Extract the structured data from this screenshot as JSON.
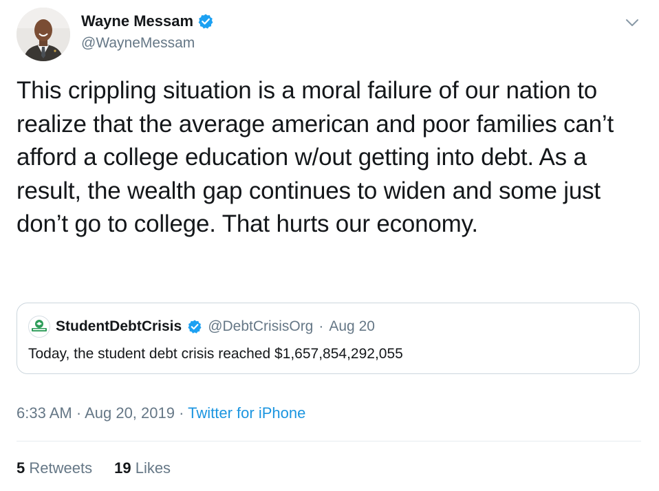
{
  "author": {
    "display_name": "Wayne Messam",
    "handle": "@WayneMessam",
    "verified": true
  },
  "tweet": {
    "text": "This crippling situation is a moral failure of our nation to realize that the average american and poor families can’t afford a college education w/out getting into debt. As a result, the wealth gap continues to widen and some just don’t go to college. That hurts our economy."
  },
  "quoted_tweet": {
    "display_name": "StudentDebtCrisis",
    "handle": "@DebtCrisisOrg",
    "separator": "·",
    "date": "Aug 20",
    "text": "Today, the student debt crisis reached $1,657,854,292,055",
    "verified": true
  },
  "meta": {
    "time": "6:33 AM",
    "separator_1": "·",
    "date": "Aug 20, 2019",
    "separator_2": "·",
    "source": "Twitter for iPhone"
  },
  "stats": {
    "retweets_count": "5",
    "retweets_label": "Retweets",
    "likes_count": "19",
    "likes_label": "Likes"
  },
  "colors": {
    "verified_blue": "#1da1f2",
    "link_blue": "#1b95e0",
    "secondary_text": "#657786",
    "border": "#ccd6dd"
  },
  "icons": {
    "caret": "chevron-down-icon",
    "verified": "verified-badge-icon"
  }
}
